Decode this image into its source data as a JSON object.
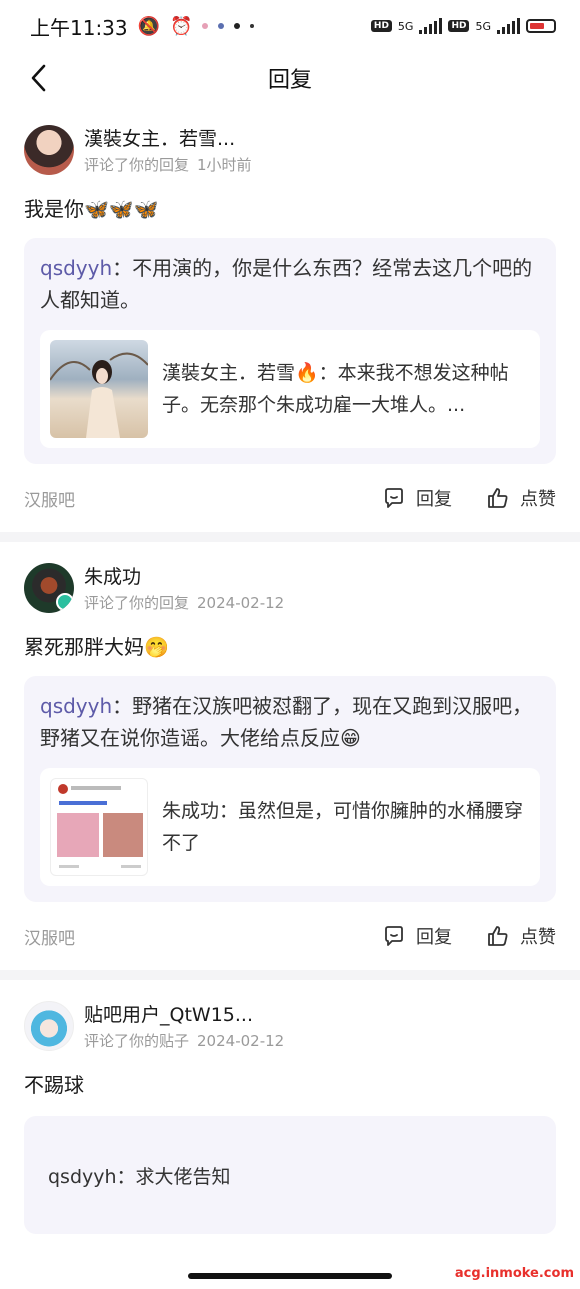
{
  "status_bar": {
    "time": "上午11:33",
    "network_1": "5G",
    "network_2": "5G",
    "hd_1": "HD",
    "hd_2": "HD"
  },
  "nav": {
    "title": "回复"
  },
  "cards": [
    {
      "user_name": "漢裝女主．若雪...",
      "action_text": "评论了你的回复",
      "time": "1小时前",
      "comment": "我是你🦋🦋🦋",
      "quote_user": "qsdyyh",
      "quote_text": "：不用演的，你是什么东西？经常去这几个吧的人都知道。",
      "inner_text": "漢裝女主．若雪🔥：本来我不想发这种帖子。无奈那个朱成功雇一大堆人。...",
      "forum": "汉服吧",
      "reply_label": "回复",
      "like_label": "点赞"
    },
    {
      "user_name": "朱成功",
      "action_text": "评论了你的回复",
      "time": "2024-02-12",
      "comment": "累死那胖大妈🤭",
      "quote_user": "qsdyyh",
      "quote_text": "：野猪在汉族吧被怼翻了，现在又跑到汉服吧，野猪又在说你造谣。大佬给点反应😁",
      "inner_text": "朱成功：虽然但是，可惜你臃肿的水桶腰穿不了",
      "forum": "汉服吧",
      "reply_label": "回复",
      "like_label": "点赞"
    },
    {
      "user_name": "贴吧用户_QtW15...",
      "action_text": "评论了你的贴子",
      "time": "2024-02-12",
      "comment": "不踢球",
      "quote_text": "qsdyyh：求大佬告知"
    }
  ],
  "watermark": "acg.inmoke.com"
}
